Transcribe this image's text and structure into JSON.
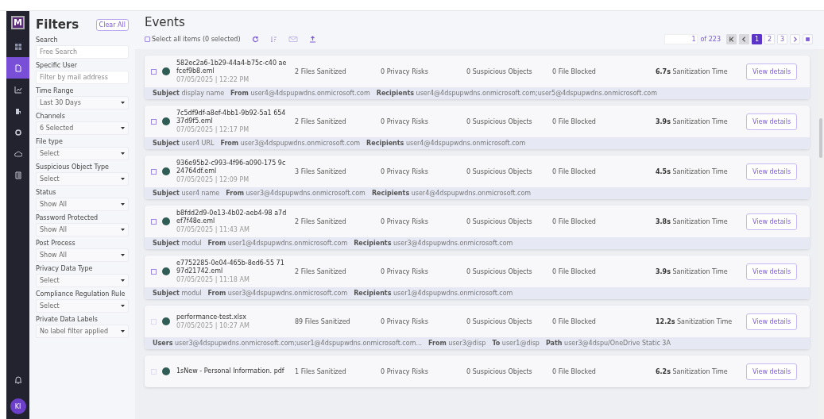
{
  "nav": {
    "logo": "M",
    "items": [
      {
        "selected": false
      },
      {
        "selected": true
      },
      {
        "selected": false
      },
      {
        "selected": false
      },
      {
        "selected": false
      },
      {
        "selected": false
      },
      {
        "selected": false
      }
    ],
    "avatar": "KI"
  },
  "filters": {
    "title": "Filters",
    "clear": "Clear All",
    "fields": [
      {
        "label": "Search",
        "kind": "text",
        "placeholder": "Free Search"
      },
      {
        "label": "Specific User",
        "kind": "text",
        "placeholder": "Filter by mail address"
      },
      {
        "label": "Time Range",
        "kind": "select",
        "value": "Last 30 Days"
      },
      {
        "label": "Channels",
        "kind": "select",
        "value": "6 Selected"
      },
      {
        "label": "File type",
        "kind": "select",
        "value": "Select"
      },
      {
        "label": "Suspicious Object Type",
        "kind": "select",
        "value": "Select"
      },
      {
        "label": "Status",
        "kind": "select",
        "value": "Show All"
      },
      {
        "label": "Password Protected",
        "kind": "select",
        "value": "Show All"
      },
      {
        "label": "Post Process",
        "kind": "select",
        "value": "Show All"
      },
      {
        "label": "Privacy Data Type",
        "kind": "select",
        "value": "Select"
      },
      {
        "label": "Compliance Regulation Rule",
        "kind": "select",
        "value": "Select"
      },
      {
        "label": "Private Data Labels",
        "kind": "select",
        "value": "No label filter applied"
      }
    ]
  },
  "events": {
    "title": "Events",
    "select_all": {
      "label": "Select all items (0 selected)",
      "checked": false
    },
    "pagination": {
      "page_input": "1",
      "of": "of 223",
      "pages": [
        {
          "label": "1",
          "selected": true
        },
        {
          "label": "2",
          "selected": false
        },
        {
          "label": "3",
          "selected": false
        }
      ]
    },
    "rows": [
      {
        "name": "582ec2a6-1b29-44a4-b75c-c40 aefcef9b8.eml",
        "time": "07/05/2025 | 12:22 PM",
        "disabled": false,
        "files": "2",
        "files_label": "Files Sanitized",
        "privacy": "0",
        "privacy_label": "Privacy Risks",
        "suspicious": "0",
        "suspicious_label": "Suspicious Objects",
        "blocked": "0",
        "blocked_label": "File Blocked",
        "sanitization": "6.7s",
        "sanitization_label": "Sanitization Time",
        "button": "View details",
        "details": [
          {
            "key": "Subject",
            "value": "display name"
          },
          {
            "key": "From",
            "value": "user4@4dspupwdns.onmicrosoft.com"
          },
          {
            "key": "Recipients",
            "value": "user4@4dspupwdns.onmicrosoft.com;user5@4dspupwdns.onmicrosoft.com"
          }
        ]
      },
      {
        "name": "7c5df9df-a8ef-4bb1-9b92-5a1 65437d9f5.eml",
        "time": "07/05/2025 | 12:17 PM",
        "disabled": false,
        "files": "2",
        "files_label": "Files Sanitized",
        "privacy": "0",
        "privacy_label": "Privacy Risks",
        "suspicious": "0",
        "suspicious_label": "Suspicious Objects",
        "blocked": "0",
        "blocked_label": "File Blocked",
        "sanitization": "3.9s",
        "sanitization_label": "Sanitization Time",
        "button": "View details",
        "details": [
          {
            "key": "Subject",
            "value": "user4 URL"
          },
          {
            "key": "From",
            "value": "user3@4dspupwdns.onmicrosoft.com"
          },
          {
            "key": "Recipients",
            "value": "user4@4dspupwdns.onmicrosoft.com"
          }
        ]
      },
      {
        "name": "936e95b2-c993-4f96-a090-175 9c24764df.eml",
        "time": "07/05/2025 | 12:09 PM",
        "disabled": false,
        "files": "3",
        "files_label": "Files Sanitized",
        "privacy": "0",
        "privacy_label": "Privacy Risks",
        "suspicious": "0",
        "suspicious_label": "Suspicious Objects",
        "blocked": "0",
        "blocked_label": "File Blocked",
        "sanitization": "4.5s",
        "sanitization_label": "Sanitization Time",
        "button": "View details",
        "details": [
          {
            "key": "Subject",
            "value": "user4 name"
          },
          {
            "key": "From",
            "value": "user3@4dspupwdns.onmicrosoft.com"
          },
          {
            "key": "Recipients",
            "value": "user4@4dspupwdns.onmicrosoft.com"
          }
        ]
      },
      {
        "name": "b8fdd2d9-0e13-4b02-aeb4-98 a7def7f48e.eml",
        "time": "07/05/2025 | 11:43 AM",
        "disabled": false,
        "files": "2",
        "files_label": "Files Sanitized",
        "privacy": "0",
        "privacy_label": "Privacy Risks",
        "suspicious": "0",
        "suspicious_label": "Suspicious Objects",
        "blocked": "0",
        "blocked_label": "File Blocked",
        "sanitization": "3.8s",
        "sanitization_label": "Sanitization Time",
        "button": "View details",
        "details": [
          {
            "key": "Subject",
            "value": "modul"
          },
          {
            "key": "From",
            "value": "user1@4dspupwdns.onmicrosoft.com"
          },
          {
            "key": "Recipients",
            "value": "user3@4dspupwdns.onmicrosoft.com"
          }
        ]
      },
      {
        "name": "e7752285-0e04-465b-8ed6-55 7197d21742.eml",
        "time": "07/05/2025 | 11:18 AM",
        "disabled": false,
        "files": "2",
        "files_label": "Files Sanitized",
        "privacy": "0",
        "privacy_label": "Privacy Risks",
        "suspicious": "0",
        "suspicious_label": "Suspicious Objects",
        "blocked": "0",
        "blocked_label": "File Blocked",
        "sanitization": "3.9s",
        "sanitization_label": "Sanitization Time",
        "button": "View details",
        "details": [
          {
            "key": "Subject",
            "value": "modul"
          },
          {
            "key": "From",
            "value": "user3@4dspupwdns.onmicrosoft.com"
          },
          {
            "key": "Recipients",
            "value": "user1@4dspupwdns.onmicrosoft.com"
          }
        ]
      },
      {
        "name": "performance-test.xlsx",
        "time": "07/05/2025 | 10:27 AM",
        "disabled": true,
        "files": "89",
        "files_label": "Files Sanitized",
        "privacy": "0",
        "privacy_label": "Privacy Risks",
        "suspicious": "0",
        "suspicious_label": "Suspicious Objects",
        "blocked": "0",
        "blocked_label": "File Blocked",
        "sanitization": "12.2s",
        "sanitization_label": "Sanitization Time",
        "button": "View details",
        "details": [
          {
            "key": "Users",
            "value": "user3@4dspupwdns.onmicrosoft.com;user1@4dspupwdns.onmicrosoft.com..."
          },
          {
            "key": "From",
            "value": "user3@disp"
          },
          {
            "key": "To",
            "value": "user1@disp"
          },
          {
            "key": "Path",
            "value": "user3@4dspu/OneDrive Static 3A"
          }
        ]
      },
      {
        "name": "1sNew - Personal Information. pdf",
        "disabled": true,
        "files": "1",
        "files_label": "Files Sanitized",
        "privacy": "0",
        "privacy_label": "Privacy Risks",
        "suspicious": "0",
        "suspicious_label": "Suspicious Objects",
        "blocked": "0",
        "blocked_label": "File Blocked",
        "sanitization": "6.2s",
        "sanitization_label": "Sanitization Time",
        "button": "View details"
      }
    ]
  }
}
